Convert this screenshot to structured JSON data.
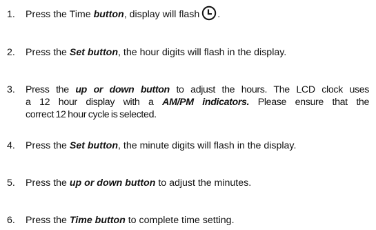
{
  "steps": [
    {
      "number": "1.",
      "parts": [
        "Press the Time ",
        "button",
        ", display will flash",
        "."
      ]
    },
    {
      "number": "2.",
      "parts": [
        "Press the ",
        "Set button",
        ", the hour digits will flash in the display."
      ]
    },
    {
      "number": "3.",
      "lines": [
        [
          "Press the ",
          "up or down button",
          " to adjust the hours. The LCD clock uses"
        ],
        [
          "a 12 hour display with a ",
          "AM/PM indicators.",
          " Please ensure that the"
        ],
        [
          "correct 12 hour cycle is selected."
        ]
      ]
    },
    {
      "number": "4.",
      "parts": [
        "Press the ",
        "Set button",
        ", the minute digits will flash in the display."
      ]
    },
    {
      "number": "5.",
      "parts": [
        "Press the ",
        "up or down button",
        " to adjust the minutes."
      ]
    },
    {
      "number": "6.",
      "parts": [
        "Press the ",
        "Time button",
        " to complete time setting."
      ]
    }
  ],
  "icons": {
    "time_flash": "clock-icon"
  }
}
